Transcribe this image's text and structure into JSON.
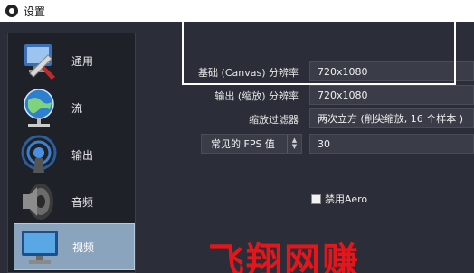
{
  "window": {
    "title": "设置"
  },
  "sidebar": {
    "items": [
      {
        "label": "通用",
        "icon": "settings-wrench-icon"
      },
      {
        "label": "流",
        "icon": "globe-stream-icon"
      },
      {
        "label": "输出",
        "icon": "broadcast-icon"
      },
      {
        "label": "音频",
        "icon": "speaker-icon"
      },
      {
        "label": "视频",
        "icon": "monitor-icon",
        "active": true
      }
    ]
  },
  "video": {
    "base_resolution_label": "基础 (Canvas) 分辨率",
    "base_resolution_value": "720x1080",
    "output_resolution_label": "输出 (缩放) 分辨率",
    "output_resolution_value": "720x1080",
    "downscale_filter_label": "缩放过滤器",
    "downscale_filter_value": "两次立方 (削尖缩放, 16 个样本 )",
    "fps_type_value": "常见的 FPS 值",
    "fps_value": "30",
    "disable_aero_label": "禁用Aero"
  },
  "watermark": {
    "text": "飞翔网赚"
  },
  "colors": {
    "background": "#2b2e38",
    "sidebar_active": "#8aa4bd",
    "field_bg": "#3a3d47",
    "watermark": "#e4161b"
  }
}
